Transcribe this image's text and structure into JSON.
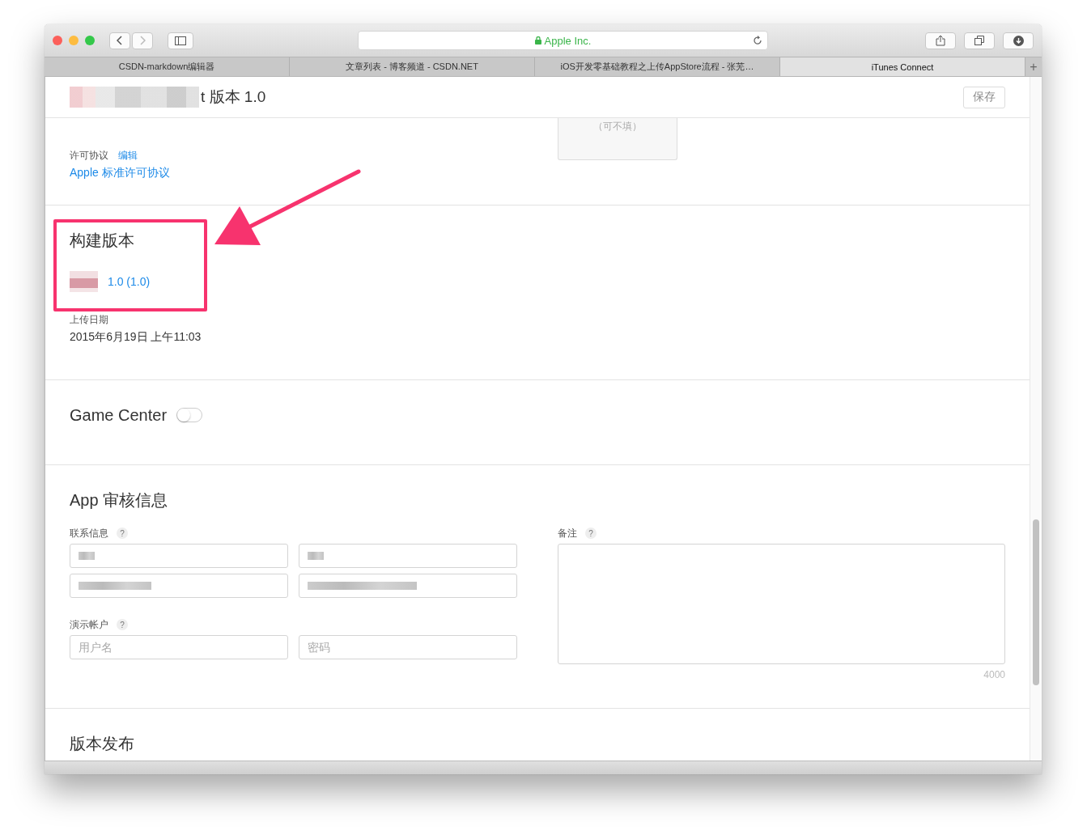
{
  "browser": {
    "address": "Apple Inc.",
    "tabs": [
      {
        "label": "CSDN-markdown编辑器",
        "selected": false
      },
      {
        "label": "文章列表 - 博客频道 - CSDN.NET",
        "selected": false
      },
      {
        "label": "iOS开发零基础教程之上传AppStore流程 - 张芜…",
        "selected": false
      },
      {
        "label": "iTunes Connect",
        "selected": true
      }
    ],
    "new_tab": "+"
  },
  "header": {
    "title": "t 版本 1.0",
    "save_button": "保存",
    "save_disabled": true
  },
  "screenshot_hint": "（可不填）",
  "license": {
    "label": "许可协议",
    "edit_link": "编辑",
    "value": "Apple 标准许可协议"
  },
  "build": {
    "title": "构建版本",
    "version": "1.0 (1.0)"
  },
  "upload_date": {
    "label": "上传日期",
    "value": "2015年6月19日 上午11:03"
  },
  "game_center": {
    "label": "Game Center",
    "on": false
  },
  "review": {
    "title": "App 审核信息",
    "contact": {
      "label": "联系信息",
      "help": "?"
    },
    "demo": {
      "label": "演示帐户",
      "help": "?",
      "fields": [
        {
          "placeholder": "用户名"
        },
        {
          "placeholder": "密码"
        }
      ]
    },
    "notes": {
      "label": "备注",
      "help": "?",
      "counter": "4000"
    }
  },
  "release": {
    "title": "版本发布"
  }
}
